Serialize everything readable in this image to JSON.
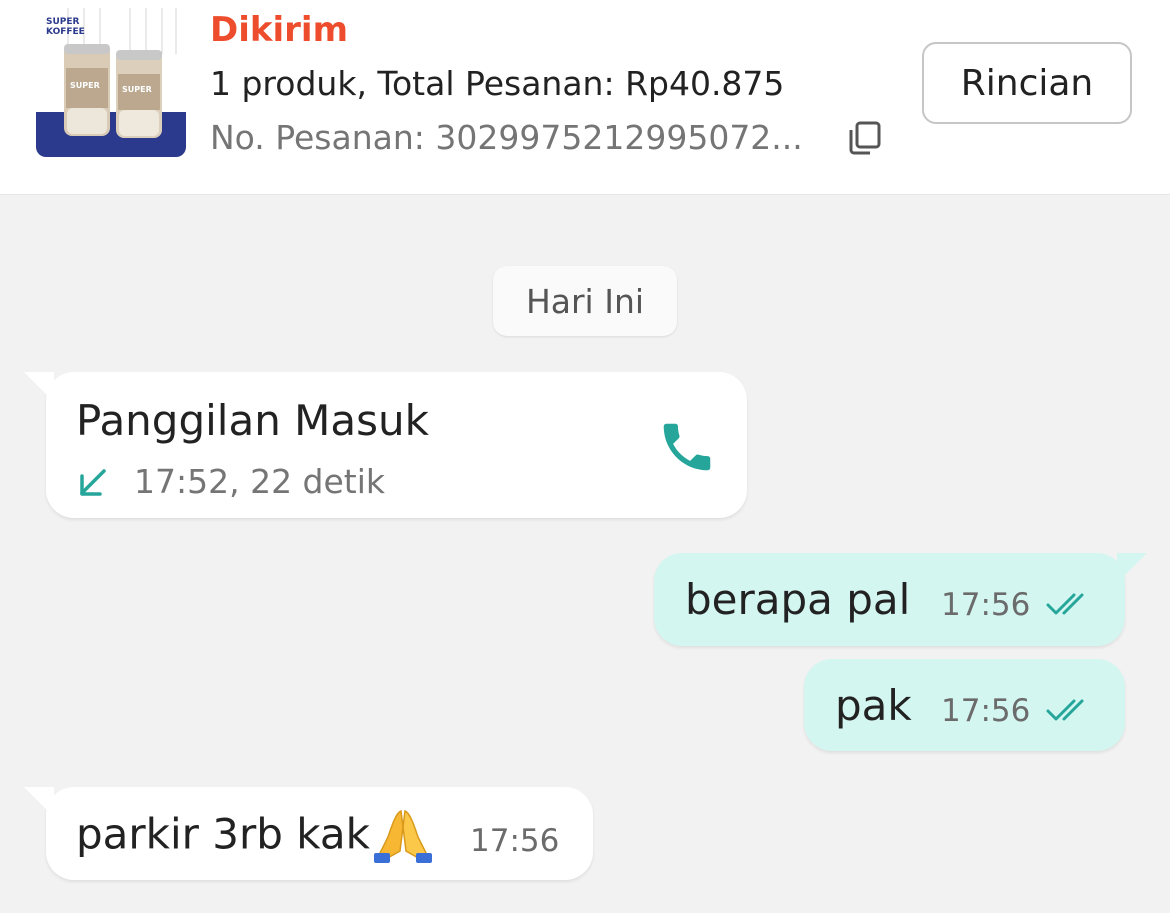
{
  "order": {
    "status": "Dikirim",
    "summary": "1 produk, Total Pesanan: Rp40.875",
    "order_number": "No. Pesanan: 3029975212995072...",
    "details_button": "Rincian",
    "product_brand_lines": [
      "SUPER",
      "KOFFEE"
    ],
    "status_color": "#ee4d2d"
  },
  "chat": {
    "date_separator": "Hari Ini",
    "accent_color": "#26a69a",
    "outgoing_bubble_color": "#d4f6f1",
    "messages": [
      {
        "type": "incoming-call",
        "title": "Panggilan Masuk",
        "meta": "17:52, 22 detik",
        "icons": [
          "incoming-call-arrow-icon",
          "phone-icon"
        ]
      },
      {
        "type": "outgoing",
        "text": "berapa pal",
        "time": "17:56",
        "status_icon": "double-check-icon"
      },
      {
        "type": "outgoing",
        "text": "pak",
        "time": "17:56",
        "status_icon": "double-check-icon"
      },
      {
        "type": "incoming",
        "text": "parkir 3rb kak",
        "emoji": "folded-hands-emoji",
        "time": "17:56"
      }
    ]
  }
}
